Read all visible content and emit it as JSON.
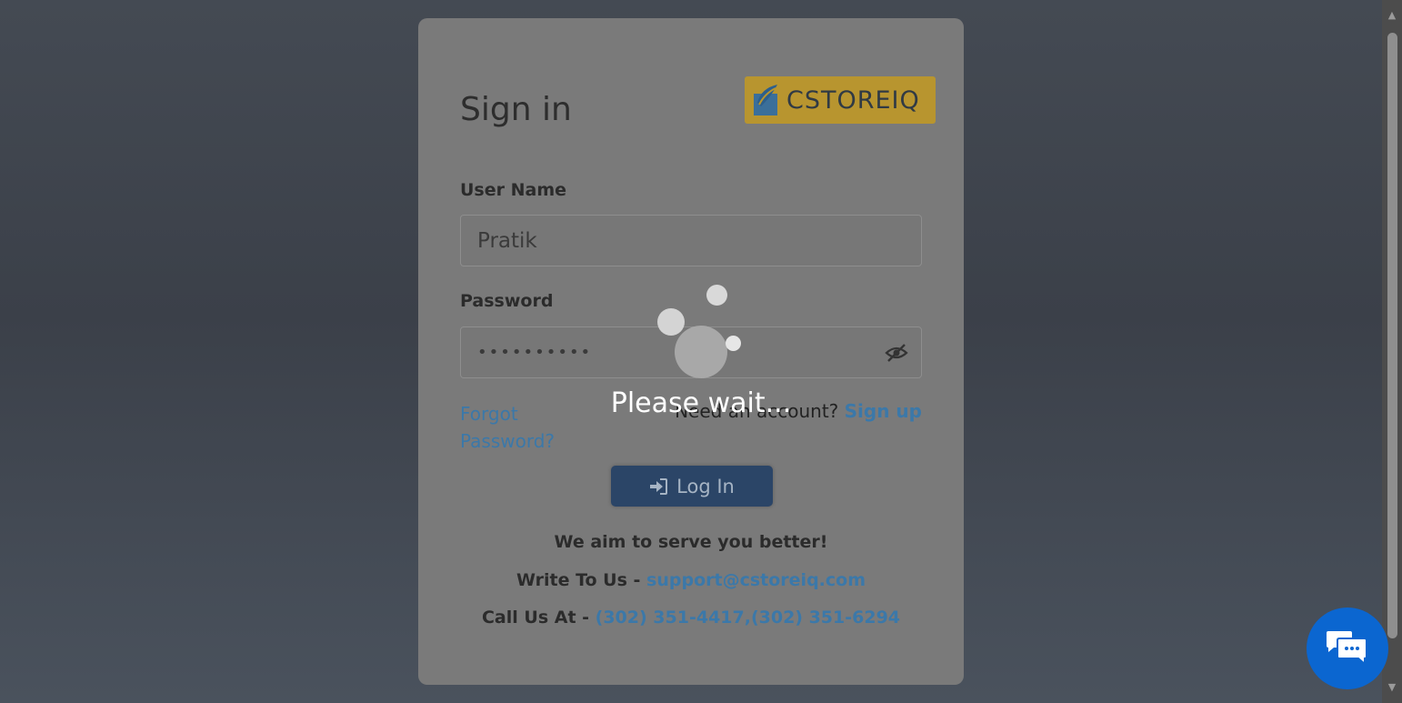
{
  "card": {
    "title": "Sign in",
    "logo_text": "CSTOREIQ",
    "username": {
      "label": "User Name",
      "value": "Pratik"
    },
    "password": {
      "label": "Password",
      "value": "••••••••••"
    },
    "forgot_link": "Forgot Password?",
    "need_account_text": "Need an account?",
    "signup_link": "Sign up",
    "login_button": "Log In",
    "tagline": "We aim to serve you better!",
    "write_prefix": "Write To Us - ",
    "email": "support@cstoreiq.com",
    "call_prefix": "Call Us At - ",
    "phones": "(302) 351-4417,(302) 351-6294"
  },
  "overlay": {
    "message": "Please wait..."
  },
  "colors": {
    "accent": "#3b78a9",
    "button": "#2b4567",
    "logo_bg": "#b8952f",
    "chat": "#0b66d0"
  },
  "icons": [
    "eye-slash-icon",
    "sign-in-icon",
    "chat-icon",
    "logo-mark-icon"
  ]
}
